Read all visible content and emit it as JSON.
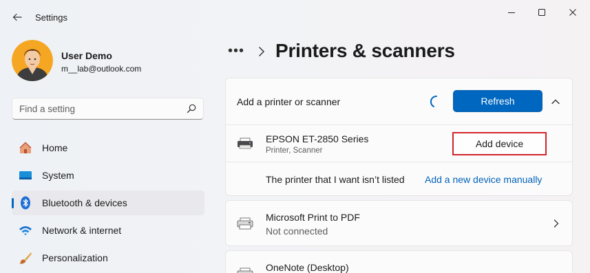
{
  "window": {
    "title": "Settings"
  },
  "user": {
    "name": "User Demo",
    "email": "m__lab@outlook.com"
  },
  "search": {
    "placeholder": "Find a setting"
  },
  "sidebar": {
    "items": [
      {
        "label": "Home",
        "icon": "home-icon"
      },
      {
        "label": "System",
        "icon": "system-icon"
      },
      {
        "label": "Bluetooth & devices",
        "icon": "bluetooth-icon",
        "active": true
      },
      {
        "label": "Network & internet",
        "icon": "wifi-icon"
      },
      {
        "label": "Personalization",
        "icon": "brush-icon"
      }
    ]
  },
  "breadcrumb": {
    "more": "•••",
    "title": "Printers & scanners"
  },
  "add_section": {
    "label": "Add a printer or scanner",
    "refresh_label": "Refresh",
    "device_name": "EPSON ET-2850 Series",
    "device_type": "Printer, Scanner",
    "add_device_label": "Add device",
    "not_listed_text": "The printer that I want isn’t listed",
    "add_manual_label": "Add a new device manually"
  },
  "printers": [
    {
      "name": "Microsoft Print to PDF",
      "status": "Not connected"
    },
    {
      "name": "OneNote (Desktop)",
      "status": ""
    }
  ],
  "colors": {
    "accent": "#0067c0",
    "highlight_border": "#d1232a",
    "link": "#0061b8"
  }
}
